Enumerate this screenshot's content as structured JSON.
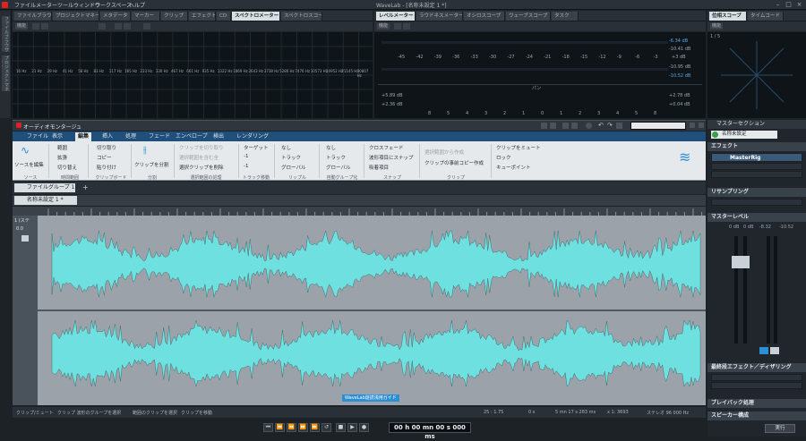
{
  "app": {
    "title": "WaveLab - [名称未設定 1 *]",
    "menus": [
      "ファイル",
      "メーター",
      "ツールウィンドウ",
      "ワークスペース",
      "ヘルプ"
    ]
  },
  "top_tabs_left": [
    "ファイルブラウザー",
    "プロジェクトマネージャー",
    "メタデータ",
    "マーカー",
    "クリップ",
    "エフェクト",
    "CD",
    "スペクトロメーター",
    "スペクトロスコープ"
  ],
  "top_tabs_mid": [
    "レベルメーター",
    "ラウドネスメーター",
    "オシロスコープ",
    "ウェーブスコープ",
    "タスク"
  ],
  "top_tabs_right": [
    "位相スコープ",
    "タイムコード"
  ],
  "mini_labels": {
    "func": "機能",
    "side1": "ファイルブラウザー",
    "side2": "プロジェクトマネージャー"
  },
  "spectro": {
    "freqs": [
      "16 Hz",
      "21 Hz",
      "29 Hz",
      "41 Hz",
      "58 Hz",
      "83 Hz",
      "117 Hz",
      "165 Hz",
      "233 Hz",
      "330 Hz",
      "467 Hz",
      "661 Hz",
      "935 Hz",
      "1322 Hz",
      "1869 Hz",
      "2643 Hz",
      "3738 Hz",
      "5286 Hz",
      "7476 Hz",
      "10573 Hz",
      "14952 Hz",
      "21145 Hz",
      "30807 Hz"
    ]
  },
  "level": {
    "scale": [
      "-45",
      "-42",
      "-39",
      "-36",
      "-33",
      "-30",
      "-27",
      "-24",
      "-21",
      "-18",
      "-15",
      "-12",
      "-9",
      "-6",
      "-3",
      "+3 dB"
    ],
    "peak_r1": "-6.34 dB",
    "peak_r2": "-10.41 dB",
    "peak_r3": "-10.95 dB",
    "peak_r4": "-10.52 dB",
    "pan_label": "パン",
    "pan_l1": "+5.89 dB",
    "pan_l2": "+2.36 dB",
    "pan_r1": "+2.78 dB",
    "pan_r2": "+0.04 dB",
    "pan_scale": [
      "8",
      "5",
      "4",
      "3",
      "2",
      "1",
      "0",
      "1",
      "2",
      "3",
      "4",
      "5",
      "8"
    ]
  },
  "phase": {
    "label": "1 / 5"
  },
  "montage": {
    "title": "オーディオモンタージュ",
    "ribbon_tabs": [
      "ファイル",
      "表示",
      "編集",
      "挿入",
      "処理",
      "フェード",
      "エンベロープ",
      "検出",
      "レンダリング"
    ]
  },
  "ribbon": {
    "source_label": "ソースを編集",
    "source_group": "ソース",
    "range": "範囲",
    "extend": "拡張",
    "swap": "切り替え",
    "clipboard_group": "時間範囲",
    "cut": "切り取り",
    "copy": "コピー",
    "paste": "貼り付け",
    "clip_group": "クリップボード",
    "split": "クリップを分割",
    "split_group": "分割",
    "clip_cut": "クリップを切り取り",
    "clip_all": "選択範囲を含む全",
    "clip_del": "選択クリップを削除",
    "sel_group": "選択範囲の処理",
    "target": "ターゲット",
    "t1": "-1",
    "t2": "-1",
    "track_group": "トラック移動",
    "none1": "なし",
    "track1": "トラック",
    "global1": "グローバル",
    "ripple_group": "リップル",
    "none2": "なし",
    "track2": "トラック",
    "global2": "グローバル",
    "auto_group": "自動グループ化",
    "crossfade": "クロスフェード",
    "snap_wave": "波形項目にスナップ",
    "snap_grid": "吸着項目",
    "snap_group": "スナップ",
    "sel_create": "選択範囲から作成",
    "clip_copy": "クリップの事前コピー作成",
    "clip_group2": "クリップ",
    "mute": "クリップをミュート",
    "lock": "ロック",
    "cue": "キューポイント"
  },
  "file_tab": "ファイルグループ 1",
  "doc_tab": "名称未設定 1 *",
  "track": {
    "num": "1 (ステ",
    "vol": "0.0"
  },
  "status_left": [
    "クリップ/ミュート",
    "クリップ 波形のグループを選択",
    "範囲のクリップを選択",
    "クリップを移動"
  ],
  "status_right": {
    "ratio": "25 : 1.75",
    "pos0": "0 s",
    "pos1": "5 mn 17 s 283 ms",
    "zoom": "x 1: 3693",
    "rate": "ステレオ 96 000 Hz"
  },
  "tooltip": "WaveLab遊読浅用ガイド",
  "timecode": "00 h 00 mn 00 s 000 ms",
  "transport": [
    "⏮",
    "⏪",
    "⏪",
    "⏩",
    "⏩",
    "↺",
    "■",
    "▶",
    "●"
  ],
  "right_panel": {
    "master_section": "マスターセクション",
    "preset": "名称未設定",
    "effects": "エフェクト",
    "master_rig": "MasterRig",
    "resampling": "リサンプリング",
    "master_level": "マスターレベル",
    "lev_a": "0 dB",
    "lev_b": "0 dB",
    "lev_c": "-8.32",
    "lev_d": "-10.52",
    "final_effects": "最終段エフェクト／ディザリング",
    "playback": "プレイバック処理",
    "speaker": "スピーカー構成",
    "render": "実行"
  },
  "colors": {
    "wave": "#6ee0e0",
    "accent": "#2b8fd6",
    "ribbon_bg": "#e6e9ec"
  }
}
